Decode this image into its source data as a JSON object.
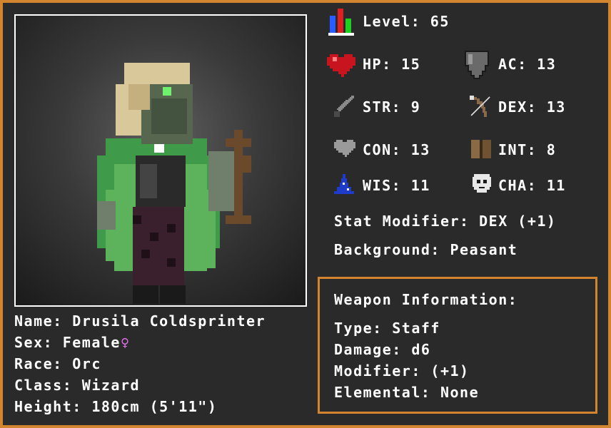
{
  "character": {
    "name_label": "Name:",
    "name": "Drusila Coldsprinter",
    "sex_label": "Sex:",
    "sex": "Female",
    "sex_symbol": "♀",
    "race_label": "Race:",
    "race": "Orc",
    "class_label": "Class:",
    "class": "Wizard",
    "height_label": "Height:",
    "height": "180cm (5'11\")"
  },
  "stats": {
    "level_label": "Level:",
    "level": "65",
    "hp_label": "HP:",
    "hp": "15",
    "ac_label": "AC:",
    "ac": "13",
    "str_label": "STR:",
    "str": "9",
    "dex_label": "DEX:",
    "dex": "13",
    "con_label": "CON:",
    "con": "13",
    "int_label": "INT:",
    "int": "8",
    "wis_label": "WIS:",
    "wis": "11",
    "cha_label": "CHA:",
    "cha": "11",
    "stat_modifier_label": "Stat Modifier:",
    "stat_modifier": "DEX (+1)",
    "background_label": "Background:",
    "background": "Peasant"
  },
  "weapon": {
    "title": "Weapon Information:",
    "type_label": "Type:",
    "type": "Staff",
    "damage_label": "Damage:",
    "damage": "d6",
    "modifier_label": "Modifier:",
    "modifier": "(+1)",
    "elemental_label": "Elemental:",
    "elemental": "None"
  },
  "icons": {
    "level": "bar-chart-icon",
    "hp": "heart-icon",
    "ac": "shield-icon",
    "str": "sword-icon",
    "dex": "bow-icon",
    "con": "grey-heart-icon",
    "int": "book-icon",
    "wis": "wizard-hat-icon",
    "cha": "mask-icon"
  },
  "colors": {
    "border": "#d2842f",
    "female_symbol": "#e070e8",
    "text": "#ffffff"
  }
}
